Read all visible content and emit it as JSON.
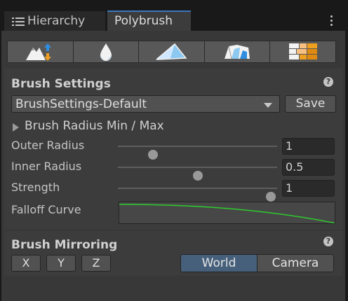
{
  "tabs": {
    "hierarchy_label": "Hierarchy",
    "polybrush_label": "Polybrush"
  },
  "modes": [
    {
      "name": "sculpt-mode",
      "icon": "mountain-raise-icon"
    },
    {
      "name": "smooth-mode",
      "icon": "water-drop-icon"
    },
    {
      "name": "paint-mode",
      "icon": "triangle-mesh-icon"
    },
    {
      "name": "scatter-mode",
      "icon": "crystal-mesh-icon"
    },
    {
      "name": "texture-mode",
      "icon": "texture-blocks-icon"
    }
  ],
  "brush_settings": {
    "title": "Brush Settings",
    "preset": "BrushSettings-Default",
    "save_label": "Save",
    "radius_foldout": "Brush Radius Min / Max",
    "outer_radius": {
      "label": "Outer Radius",
      "value": "1",
      "slider_fraction": 0.22
    },
    "inner_radius": {
      "label": "Inner Radius",
      "value": "0.5",
      "slider_fraction": 0.5
    },
    "strength": {
      "label": "Strength",
      "value": "1",
      "slider_fraction": 0.96
    },
    "falloff_label": "Falloff Curve"
  },
  "mirroring": {
    "title": "Brush Mirroring",
    "x_label": "X",
    "y_label": "Y",
    "z_label": "Z",
    "world_label": "World",
    "camera_label": "Camera",
    "selected": "World"
  },
  "colors": {
    "accent": "#3a79bb",
    "curve": "#2ecc2e",
    "selected_segment": "#46607c",
    "icon_blue": "#2f8ee0",
    "icon_orange": "#f0a020"
  }
}
